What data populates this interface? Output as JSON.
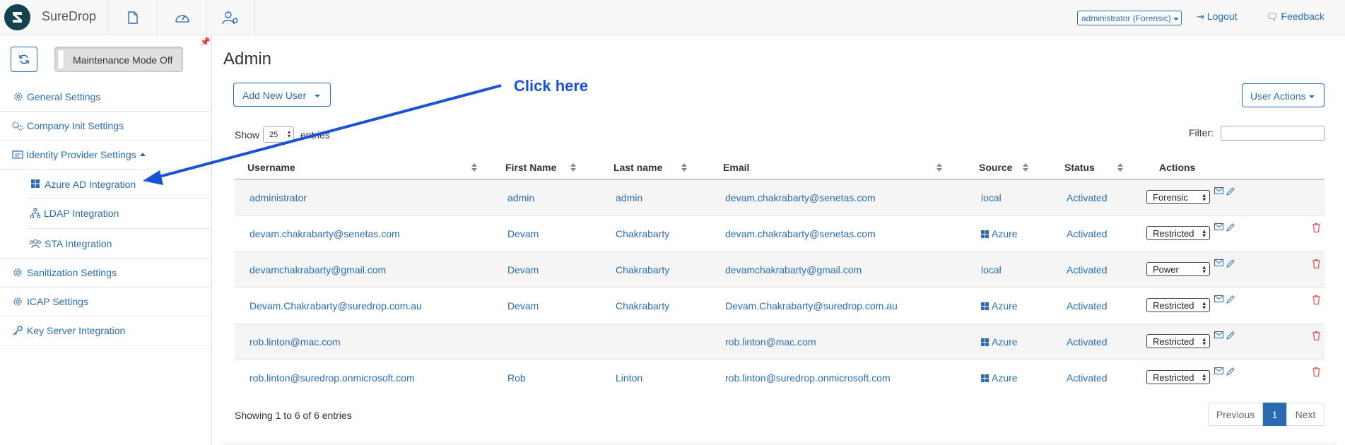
{
  "app": {
    "brand": "SureDrop"
  },
  "header": {
    "user_menu": "administrator (Forensic)",
    "logout": "Logout",
    "feedback": "Feedback"
  },
  "sidebar": {
    "maintenance_label": "Maintenance Mode Off",
    "items": [
      {
        "label": "General Settings",
        "icon": "gear-icon"
      },
      {
        "label": "Company Init Settings",
        "icon": "gears-icon"
      },
      {
        "label": "Identity Provider Settings",
        "icon": "id-card-icon"
      },
      {
        "label": "Azure AD Integration",
        "icon": "windows-icon"
      },
      {
        "label": "LDAP Integration",
        "icon": "sitemap-icon"
      },
      {
        "label": "STA Integration",
        "icon": "users-icon"
      },
      {
        "label": "Sanitization Settings",
        "icon": "sanitize-icon"
      },
      {
        "label": "ICAP Settings",
        "icon": "icap-icon"
      },
      {
        "label": "Key Server Integration",
        "icon": "key-icon"
      }
    ]
  },
  "main": {
    "title": "Admin",
    "add_user_label": "Add New User",
    "user_actions_label": "User Actions",
    "annotation": "Click here",
    "show_prefix": "Show",
    "show_value": "25",
    "show_suffix": "entries",
    "filter_label": "Filter:",
    "columns": [
      "Username",
      "First Name",
      "Last name",
      "Email",
      "Source",
      "Status",
      "Actions"
    ],
    "rows": [
      {
        "username": "administrator",
        "first": "admin",
        "last": "admin",
        "email": "devam.chakrabarty@senetas.com",
        "source": "local",
        "azure": false,
        "status": "Activated",
        "role": "Forensic",
        "deletable": false
      },
      {
        "username": "devam.chakrabarty@senetas.com",
        "first": "Devam",
        "last": "Chakrabarty",
        "email": "devam.chakrabarty@senetas.com",
        "source": "Azure",
        "azure": true,
        "status": "Activated",
        "role": "Restricted",
        "deletable": true
      },
      {
        "username": "devamchakrabarty@gmail.com",
        "first": "Devam",
        "last": "Chakrabarty",
        "email": "devamchakrabarty@gmail.com",
        "source": "local",
        "azure": false,
        "status": "Activated",
        "role": "Power",
        "deletable": true
      },
      {
        "username": "Devam.Chakrabarty@suredrop.com.au",
        "first": "Devam",
        "last": "Chakrabarty",
        "email": "Devam.Chakrabarty@suredrop.com.au",
        "source": "Azure",
        "azure": true,
        "status": "Activated",
        "role": "Restricted",
        "deletable": true
      },
      {
        "username": "rob.linton@mac.com",
        "first": "",
        "last": "",
        "email": "rob.linton@mac.com",
        "source": "Azure",
        "azure": true,
        "status": "Activated",
        "role": "Restricted",
        "deletable": true
      },
      {
        "username": "rob.linton@suredrop.onmicrosoft.com",
        "first": "Rob",
        "last": "Linton",
        "email": "rob.linton@suredrop.onmicrosoft.com",
        "source": "Azure",
        "azure": true,
        "status": "Activated",
        "role": "Restricted",
        "deletable": true
      }
    ],
    "showing_text": "Showing 1 to 6 of 6 entries",
    "pager": {
      "previous": "Previous",
      "current": "1",
      "next": "Next"
    }
  },
  "colors": {
    "link": "#2b6cb0",
    "annotation": "#1a52d6",
    "delete": "#d9534f",
    "logo": "#14434f"
  }
}
